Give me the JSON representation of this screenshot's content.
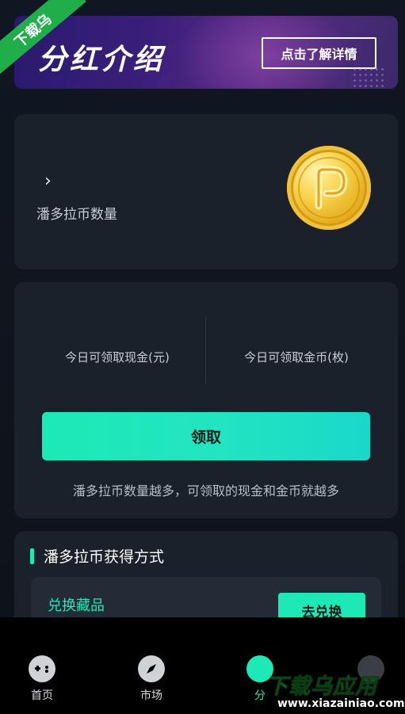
{
  "banner": {
    "title": "分红介绍",
    "detail_button": "点击了解详情"
  },
  "watermark": {
    "ribbon": "下载乌",
    "brand": "下载乌应用",
    "url": "www.xiazainiao.com"
  },
  "coins_card": {
    "label": "潘多拉币数量",
    "coin_icon": "gold-coin-icon"
  },
  "claim_card": {
    "cash_label": "今日可领取现金(元)",
    "gold_label": "今日可领取金币(枚)",
    "claim_button": "领取",
    "note": "潘多拉币数量越多，可领取的现金和金币就越多"
  },
  "ways_card": {
    "title": "潘多拉币获得方式",
    "item_label": "兑换藏品",
    "item_button": "去兑换"
  },
  "tabbar": {
    "items": [
      {
        "label": "首页",
        "icon": "gamepad-icon"
      },
      {
        "label": "市场",
        "icon": "compass-icon"
      },
      {
        "label": "分",
        "icon": "bonus-icon"
      },
      {
        "label": "",
        "icon": "user-icon"
      }
    ]
  },
  "colors": {
    "accent": "#1de9b6",
    "background": "#0f141c",
    "card": "#1a212b",
    "tabbar": "#000000"
  }
}
